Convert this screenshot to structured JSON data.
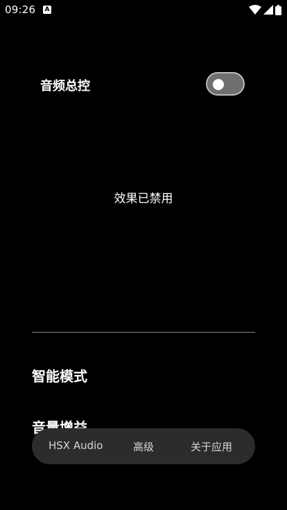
{
  "status_bar": {
    "time": "09:26",
    "notification_icon": "A"
  },
  "master_control": {
    "label": "音频总控",
    "toggle_on": false
  },
  "effect_status": "效果已禁用",
  "sections": {
    "smart_mode": "智能模式",
    "volume_gain": "音量增益"
  },
  "nav": {
    "items": [
      {
        "label": "HSX Audio"
      },
      {
        "label": "高级"
      },
      {
        "label": "关于应用"
      }
    ]
  },
  "colors": {
    "background": "#000000",
    "text": "#ffffff",
    "toggle_track_off": "#6f6f6f",
    "nav_background": "#2c2c2c"
  }
}
